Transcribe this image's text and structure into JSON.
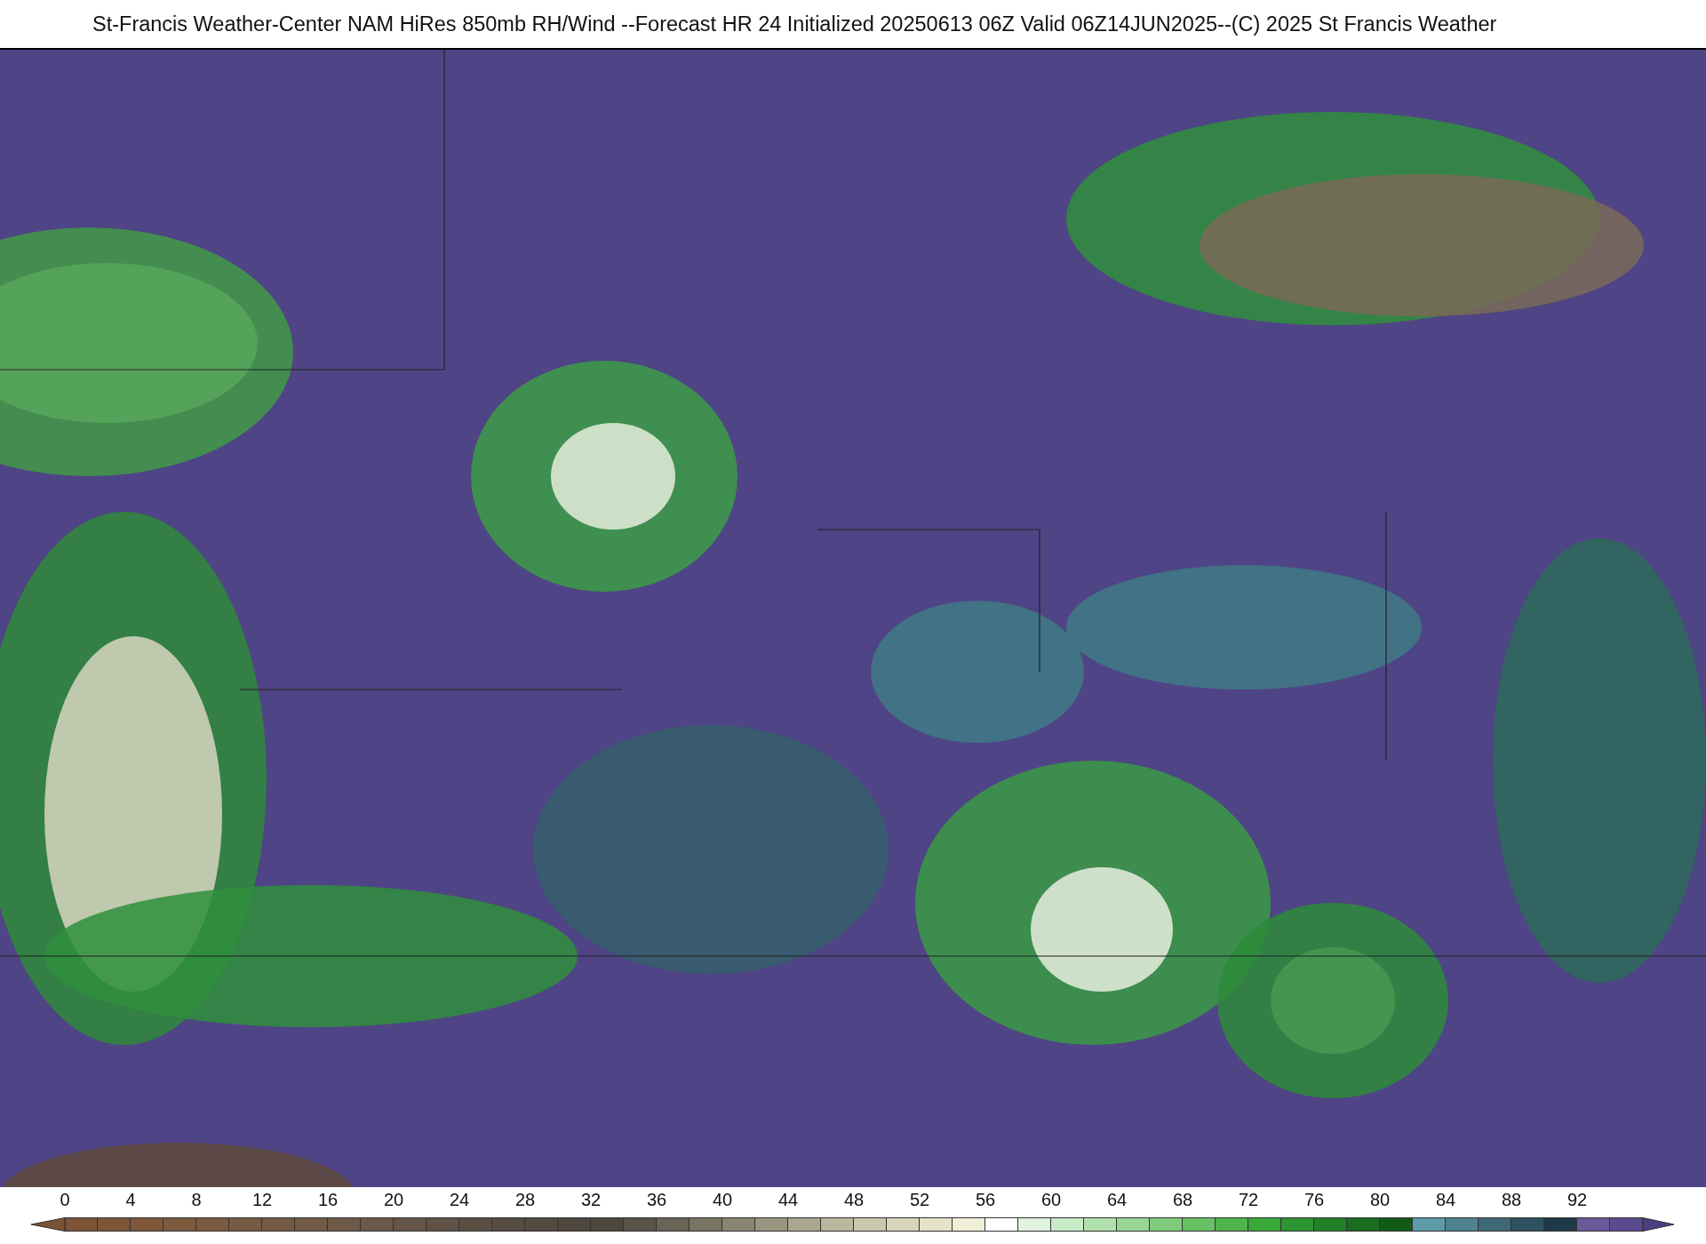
{
  "title": "St-Francis Weather-Center NAM HiRes 850mb RH/Wind  --Forecast HR 24 Initialized 20250613 06Z Valid 06Z14JUN2025--(C) 2025 St Francis Weather",
  "colorbar": {
    "labels": [
      "0",
      "4",
      "8",
      "12",
      "16",
      "20",
      "24",
      "28",
      "32",
      "36",
      "40",
      "44",
      "48",
      "52",
      "56",
      "60",
      "64",
      "68",
      "72",
      "76",
      "80",
      "84",
      "88",
      "92"
    ],
    "low_arrow": {
      "color": "#7b5337"
    },
    "high_arrow": {
      "color": "#4b3f82"
    },
    "segments": [
      {
        "color": "#7b5337"
      },
      {
        "color": "#7d5539"
      },
      {
        "color": "#7f573b"
      },
      {
        "color": "#7d5a3e"
      },
      {
        "color": "#7a5a40"
      },
      {
        "color": "#775a42"
      },
      {
        "color": "#745a44"
      },
      {
        "color": "#715a46"
      },
      {
        "color": "#6e5a48"
      },
      {
        "color": "#6a5848"
      },
      {
        "color": "#655548"
      },
      {
        "color": "#605246"
      },
      {
        "color": "#5b4f44"
      },
      {
        "color": "#574c42"
      },
      {
        "color": "#534a40"
      },
      {
        "color": "#50483f"
      },
      {
        "color": "#4e473e"
      },
      {
        "color": "#5a5448"
      },
      {
        "color": "#6a6456"
      },
      {
        "color": "#7a7464"
      },
      {
        "color": "#8a8572"
      },
      {
        "color": "#9a9580"
      },
      {
        "color": "#aba690"
      },
      {
        "color": "#bbb69e"
      },
      {
        "color": "#cbc6ae"
      },
      {
        "color": "#d8d4ba"
      },
      {
        "color": "#e5e2c8"
      },
      {
        "color": "#f0eed6"
      },
      {
        "color": "#ffffff"
      },
      {
        "color": "#e0f2e0"
      },
      {
        "color": "#c8ebc8"
      },
      {
        "color": "#b0e0ac"
      },
      {
        "color": "#98d694"
      },
      {
        "color": "#80cc7c"
      },
      {
        "color": "#68c064"
      },
      {
        "color": "#50b44c"
      },
      {
        "color": "#3aa838"
      },
      {
        "color": "#2c9430"
      },
      {
        "color": "#228028"
      },
      {
        "color": "#1a6c20"
      },
      {
        "color": "#135a18"
      },
      {
        "color": "#5e9aa8"
      },
      {
        "color": "#4e8290"
      },
      {
        "color": "#3e6a78"
      },
      {
        "color": "#2e5260"
      },
      {
        "color": "#1e3a48"
      },
      {
        "color": "#6a5a9a"
      },
      {
        "color": "#5a4a8e"
      }
    ]
  }
}
